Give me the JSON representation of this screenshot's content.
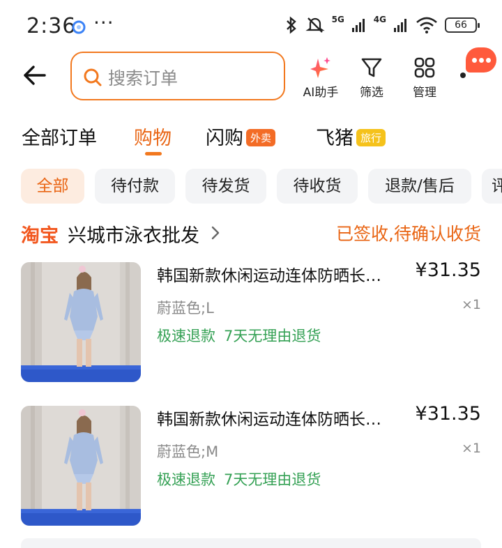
{
  "status_bar": {
    "time": "2:36",
    "overflow": "···",
    "signal_1": "5G",
    "signal_2": "4G",
    "battery": "66"
  },
  "header": {
    "search_placeholder": "搜索订单",
    "ai_label": "AI助手",
    "filter_label": "筛选",
    "manage_label": "管理"
  },
  "order_tabs": [
    {
      "label": "全部订单",
      "active": false
    },
    {
      "label": "购物",
      "active": true
    },
    {
      "label": "闪购",
      "badge": "外卖"
    },
    {
      "label": "飞猪",
      "badge": "旅行"
    }
  ],
  "filter_chips": [
    "全部",
    "待付款",
    "待发货",
    "待收货",
    "退款/售后",
    "评"
  ],
  "shop": {
    "platform": "淘宝",
    "name": "兴城市泳衣批发",
    "status": "已签收,待确认收货"
  },
  "items": [
    {
      "title": "韩国新款休闲运动连体防晒长…",
      "price": "¥31.35",
      "spec": "蔚蓝色;L",
      "qty": "×1",
      "tag_1": "极速退款",
      "tag_2": "7天无理由退货"
    },
    {
      "title": "韩国新款休闲运动连体防晒长…",
      "price": "¥31.35",
      "spec": "蔚蓝色;M",
      "qty": "×1",
      "tag_1": "极速退款",
      "tag_2": "7天无理由退货"
    }
  ],
  "colors": {
    "accent": "#f2781e",
    "brand_taobao": "#f2561d",
    "tag_green": "#35a155"
  }
}
